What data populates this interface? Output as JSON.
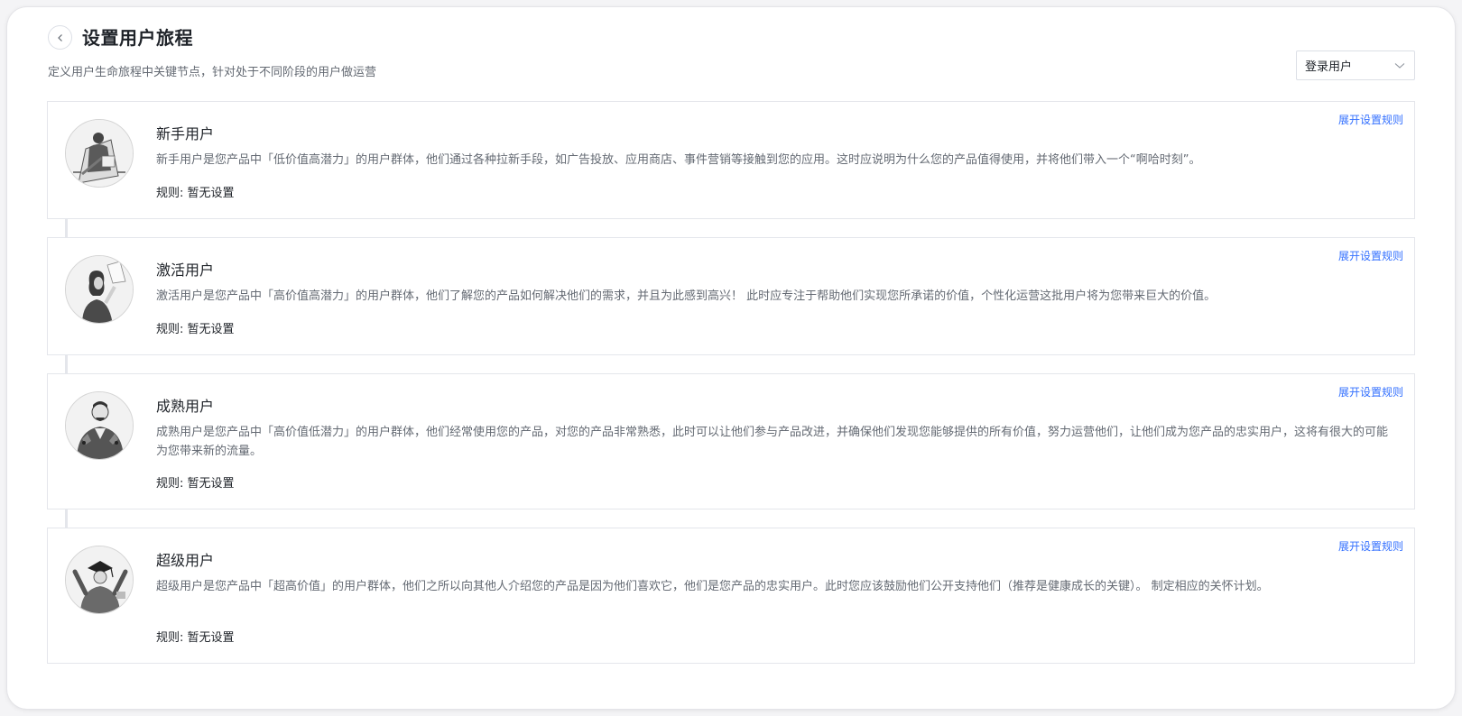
{
  "header": {
    "title": "设置用户旅程",
    "subtitle": "定义用户生命旅程中关键节点，针对处于不同阶段的用户做运营",
    "back_icon": "chevron-left-icon"
  },
  "user_filter": {
    "selected": "登录用户",
    "icon": "chevron-down-icon"
  },
  "stages": [
    {
      "name": "新手用户",
      "description": "新手用户是您产品中「低价值高潜力」的用户群体，他们通过各种拉新手段，如广告投放、应用商店、事件营销等接触到您的应用。这时应说明为什么您的产品值得使用，并将他们带入一个“啊哈时刻”。",
      "rule": "规则: 暂无设置",
      "expand_label": "展开设置规则"
    },
    {
      "name": "激活用户",
      "description": "激活用户是您产品中「高价值高潜力」的用户群体，他们了解您的产品如何解决他们的需求，并且为此感到高兴！ 此时应专注于帮助他们实现您所承诺的价值，个性化运营这批用户将为您带来巨大的价值。",
      "rule": "规则: 暂无设置",
      "expand_label": "展开设置规则"
    },
    {
      "name": "成熟用户",
      "description": "成熟用户是您产品中「高价值低潜力」的用户群体，他们经常使用您的产品，对您的产品非常熟悉，此时可以让他们参与产品改进，并确保他们发现您能够提供的所有价值，努力运营他们，让他们成为您产品的忠实用户，这将有很大的可能为您带来新的流量。",
      "rule": "规则: 暂无设置",
      "expand_label": "展开设置规则"
    },
    {
      "name": "超级用户",
      "description": "超级用户是您产品中「超高价值」的用户群体，他们之所以向其他人介绍您的产品是因为他们喜欢它，他们是您产品的忠实用户。此时您应该鼓励他们公开支持他们（推荐是健康成长的关键）。 制定相应的关怀计划。",
      "rule": "规则: 暂无设置",
      "expand_label": "展开设置规则"
    }
  ],
  "colors": {
    "link": "#3370ff",
    "border": "#e4e6eb",
    "text_secondary": "#646a73"
  }
}
